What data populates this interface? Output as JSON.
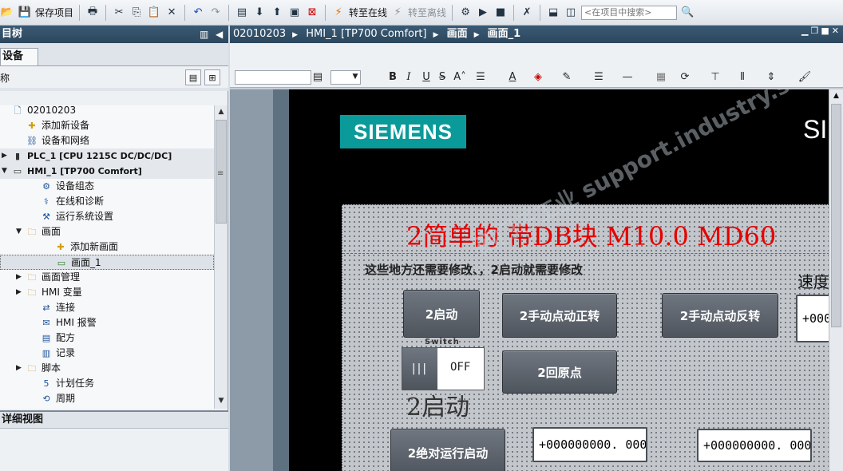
{
  "toolbar": {
    "save_project": "保存项目",
    "go_online": "转至在线",
    "go_offline": "转至离线",
    "search_placeholder": "<在项目中搜索>"
  },
  "project_tree": {
    "header": "目树",
    "tab_devices": "设备",
    "filter_label": "称",
    "items": [
      {
        "label": "02010203",
        "indent": 0,
        "expander": "",
        "icon": "project-icon"
      },
      {
        "label": "添加新设备",
        "indent": 1,
        "expander": "",
        "icon": "add-device-icon"
      },
      {
        "label": "设备和网络",
        "indent": 1,
        "expander": "",
        "icon": "network-icon"
      },
      {
        "label": "PLC_1 [CPU 1215C DC/DC/DC]",
        "indent": 0,
        "expander": "▶",
        "icon": "plc-icon"
      },
      {
        "label": "HMI_1 [TP700 Comfort]",
        "indent": 0,
        "expander": "▼",
        "icon": "hmi-icon"
      },
      {
        "label": "设备组态",
        "indent": 2,
        "expander": "",
        "icon": "device-config-icon"
      },
      {
        "label": "在线和诊断",
        "indent": 2,
        "expander": "",
        "icon": "diagnostics-icon"
      },
      {
        "label": "运行系统设置",
        "indent": 2,
        "expander": "",
        "icon": "runtime-settings-icon"
      },
      {
        "label": "画面",
        "indent": 1,
        "expander": "▼",
        "icon": "folder-icon"
      },
      {
        "label": "添加新画面",
        "indent": 3,
        "expander": "",
        "icon": "add-screen-icon"
      },
      {
        "label": "画面_1",
        "indent": 3,
        "expander": "",
        "icon": "screen-icon"
      },
      {
        "label": "画面管理",
        "indent": 1,
        "expander": "▶",
        "icon": "screen-management-icon"
      },
      {
        "label": "HMI 变量",
        "indent": 1,
        "expander": "▶",
        "icon": "hmi-tags-icon"
      },
      {
        "label": "连接",
        "indent": 2,
        "expander": "",
        "icon": "connections-icon"
      },
      {
        "label": "HMI 报警",
        "indent": 2,
        "expander": "",
        "icon": "alarm-icon"
      },
      {
        "label": "配方",
        "indent": 2,
        "expander": "",
        "icon": "recipe-icon"
      },
      {
        "label": "记录",
        "indent": 2,
        "expander": "",
        "icon": "log-icon"
      },
      {
        "label": "脚本",
        "indent": 1,
        "expander": "▶",
        "icon": "scripts-icon"
      },
      {
        "label": "计划任务",
        "indent": 2,
        "expander": "",
        "icon": "scheduled-task-icon"
      },
      {
        "label": "周期",
        "indent": 2,
        "expander": "",
        "icon": "cycle-icon"
      }
    ]
  },
  "detail_view": {
    "header": "详细视图"
  },
  "editor": {
    "breadcrumb": [
      "02010203",
      "HMI_1 [TP700 Comfort]",
      "画面",
      "画面_1"
    ]
  },
  "hmi": {
    "logo": "SIEMENS",
    "logo_right": "SI",
    "title": "2简单的 带DB块  M10.0   MD60",
    "note": "这些地方还需要修改、，2启动就需要修改",
    "speed_label": "速度",
    "btn_start": "2启动",
    "btn_jog_forward": "2手动点动正转",
    "btn_jog_reverse": "2手动点动反转",
    "btn_home": "2回原点",
    "btn_abs_start": "2绝对运行启动",
    "switch_label": "Switch",
    "switch_state": "OFF",
    "status_text": "2启动",
    "io_speed": "+000",
    "io_value_1": "+000000000. 000",
    "io_value_2": "+000000000. 000"
  },
  "watermark": "西门子工业 support.industry.siemens.com/cs 找答案"
}
